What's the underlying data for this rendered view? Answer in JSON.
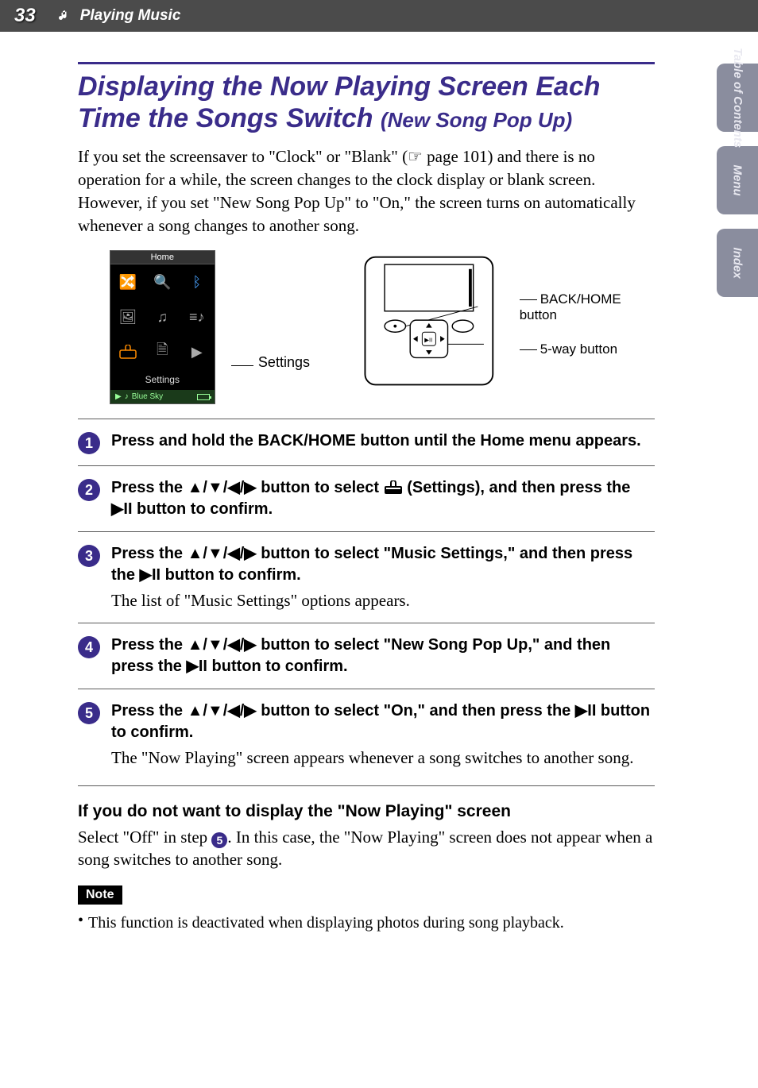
{
  "header": {
    "page_number": "33",
    "section": "Playing Music"
  },
  "side_tabs": {
    "toc": "Table of\nContents",
    "menu": "Menu",
    "index": "Index"
  },
  "title": {
    "main": "Displaying the Now Playing Screen Each Time the Songs Switch",
    "sub": "(New Song Pop Up)"
  },
  "intro": "If you set the screensaver to \"Clock\" or \"Blank\" (☞ page 101) and there is no operation for a while, the screen changes to the clock display or blank screen. However, if you set \"New Song Pop Up\" to \"On,\" the screen turns on automatically whenever a song changes to another song.",
  "figure": {
    "home_title": "Home",
    "home_label": "Settings",
    "now_playing": "Blue Sky",
    "callout_settings": "Settings",
    "label_back": "BACK/HOME button",
    "label_5way": "5-way button"
  },
  "steps": [
    {
      "num": "1",
      "head": "Press and hold the BACK/HOME button until the Home menu appears."
    },
    {
      "num": "2",
      "head_parts": {
        "a": "Press the ",
        "arrows": "▲/▼/◀/▶",
        "b": " button to select ",
        "c": " (Settings), and then press the ",
        "play": "▶II",
        "d": " button to confirm."
      }
    },
    {
      "num": "3",
      "head_parts": {
        "a": "Press the ",
        "arrows": "▲/▼/◀/▶",
        "b": " button to select \"Music Settings,\" and then press the ",
        "play": "▶II",
        "c": " button to confirm."
      },
      "text": "The list of \"Music Settings\" options appears."
    },
    {
      "num": "4",
      "head_parts": {
        "a": "Press the ",
        "arrows": "▲/▼/◀/▶",
        "b": " button to select \"New Song Pop Up,\" and then press the ",
        "play": "▶II",
        "c": " button to confirm."
      }
    },
    {
      "num": "5",
      "head_parts": {
        "a": "Press the ",
        "arrows": "▲/▼/◀/▶",
        "b": " button to select \"On,\" and then press the ",
        "play": "▶II",
        "c": " button to confirm."
      },
      "text": "The \"Now Playing\" screen appears whenever a song switches to another song."
    }
  ],
  "after": {
    "heading": "If you do not want to display the \"Now Playing\" screen",
    "text_a": "Select \"Off\" in step ",
    "ref": "5",
    "text_b": ". In this case, the \"Now Playing\" screen does not appear when a song switches to another song."
  },
  "note": {
    "label": "Note",
    "text": "This function is deactivated when displaying photos during song playback."
  }
}
